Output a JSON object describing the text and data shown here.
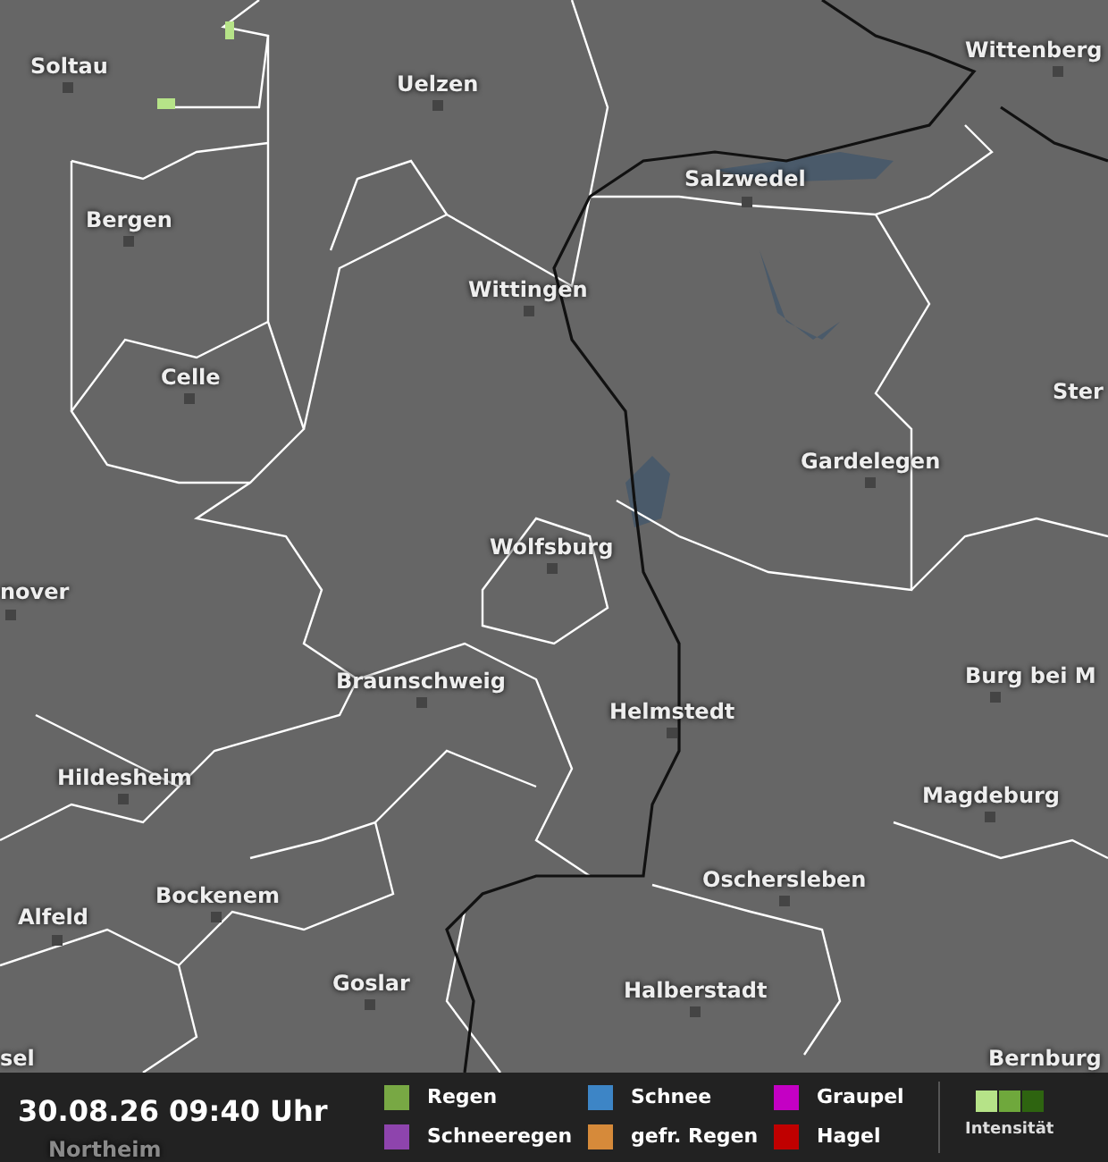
{
  "map": {
    "places": [
      {
        "name": "Soltau"
      },
      {
        "name": "Uelzen"
      },
      {
        "name": "Wittenberg"
      },
      {
        "name": "Salzwedel"
      },
      {
        "name": "Bergen"
      },
      {
        "name": "Wittingen"
      },
      {
        "name": "Celle"
      },
      {
        "name": "Ster"
      },
      {
        "name": "Gardelegen"
      },
      {
        "name": "Wolfsburg"
      },
      {
        "name": "nover"
      },
      {
        "name": "Braunschweig"
      },
      {
        "name": "Burg bei M"
      },
      {
        "name": "Helmstedt"
      },
      {
        "name": "Hildesheim"
      },
      {
        "name": "Magdeburg"
      },
      {
        "name": "Oschersleben"
      },
      {
        "name": "Bockenem"
      },
      {
        "name": "Alfeld"
      },
      {
        "name": "Goslar"
      },
      {
        "name": "Halberstadt"
      },
      {
        "name": "Bernburg"
      },
      {
        "name": "sel"
      },
      {
        "name": "Northeim"
      }
    ]
  },
  "footer": {
    "timestamp": "30.08.26 09:40 Uhr",
    "legend": [
      {
        "label": "Regen",
        "color": "#78a844"
      },
      {
        "label": "Schneeregen",
        "color": "#8e44ad"
      },
      {
        "label": "Schnee",
        "color": "#3d85c6"
      },
      {
        "label": "gefr. Regen",
        "color": "#d68a3a"
      },
      {
        "label": "Graupel",
        "color": "#c400c4"
      },
      {
        "label": "Hagel",
        "color": "#c00000"
      }
    ],
    "intensity": {
      "label": "Intensität",
      "steps": [
        {
          "color": "#b6e388"
        },
        {
          "color": "#6fa83c"
        },
        {
          "color": "#2e6410"
        }
      ]
    }
  }
}
